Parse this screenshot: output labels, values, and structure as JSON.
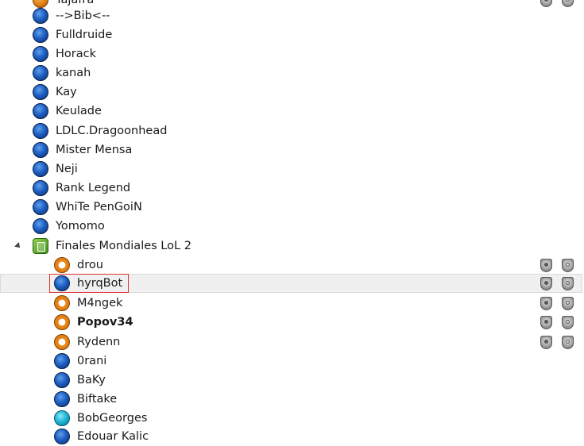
{
  "colors": {
    "selected_bg": "#f0f0f0",
    "highlight_border": "#e03030"
  },
  "tree": {
    "top_clients": [
      {
        "name": "Tajafra",
        "status": "orange-full"
      },
      {
        "name": "-->Bib<--",
        "status": "blue"
      },
      {
        "name": "Fulldruide",
        "status": "blue"
      },
      {
        "name": "Horack",
        "status": "blue"
      },
      {
        "name": "kanah",
        "status": "blue"
      },
      {
        "name": "Kay",
        "status": "blue"
      },
      {
        "name": "Keulade",
        "status": "blue"
      },
      {
        "name": "LDLC.Dragoonhead",
        "status": "blue"
      },
      {
        "name": "Mister Mensa",
        "status": "blue"
      },
      {
        "name": "Neji",
        "status": "blue"
      },
      {
        "name": "Rank Legend",
        "status": "blue"
      },
      {
        "name": "WhiTe PenGoiN",
        "status": "blue"
      },
      {
        "name": "Yomomo",
        "status": "blue"
      }
    ],
    "channel": {
      "name": "Finales Mondiales LoL 2",
      "icon": "channel-icon",
      "expanded": true
    },
    "channel_clients": [
      {
        "name": "drou",
        "status": "orange",
        "bold": false,
        "badges": [
          "server-group-shield-icon",
          "server-group-s-shield-icon"
        ]
      },
      {
        "name": "hyrqBot",
        "status": "blue-hl",
        "bold": false,
        "selected": true,
        "badges": [
          "server-group-shield-icon",
          "server-group-s-shield-icon"
        ]
      },
      {
        "name": "M4ngek",
        "status": "orange",
        "bold": false,
        "badges": [
          "server-group-shield-icon",
          "server-group-s-shield-icon"
        ]
      },
      {
        "name": "Popov34",
        "status": "orange",
        "bold": true,
        "badges": [
          "server-group-shield-icon",
          "server-group-s-shield-icon"
        ]
      },
      {
        "name": "Rydenn",
        "status": "orange",
        "bold": false,
        "badges": [
          "server-group-shield-icon",
          "server-group-s-shield-icon"
        ]
      },
      {
        "name": "0rani",
        "status": "blue",
        "bold": false,
        "badges": []
      },
      {
        "name": "BaKy",
        "status": "blue",
        "bold": false,
        "badges": []
      },
      {
        "name": "Biftake",
        "status": "blue",
        "bold": false,
        "badges": []
      },
      {
        "name": "BobGeorges",
        "status": "cyan",
        "bold": false,
        "badges": []
      },
      {
        "name": "Edouar Kalic",
        "status": "blue",
        "bold": false,
        "badges": []
      }
    ]
  }
}
